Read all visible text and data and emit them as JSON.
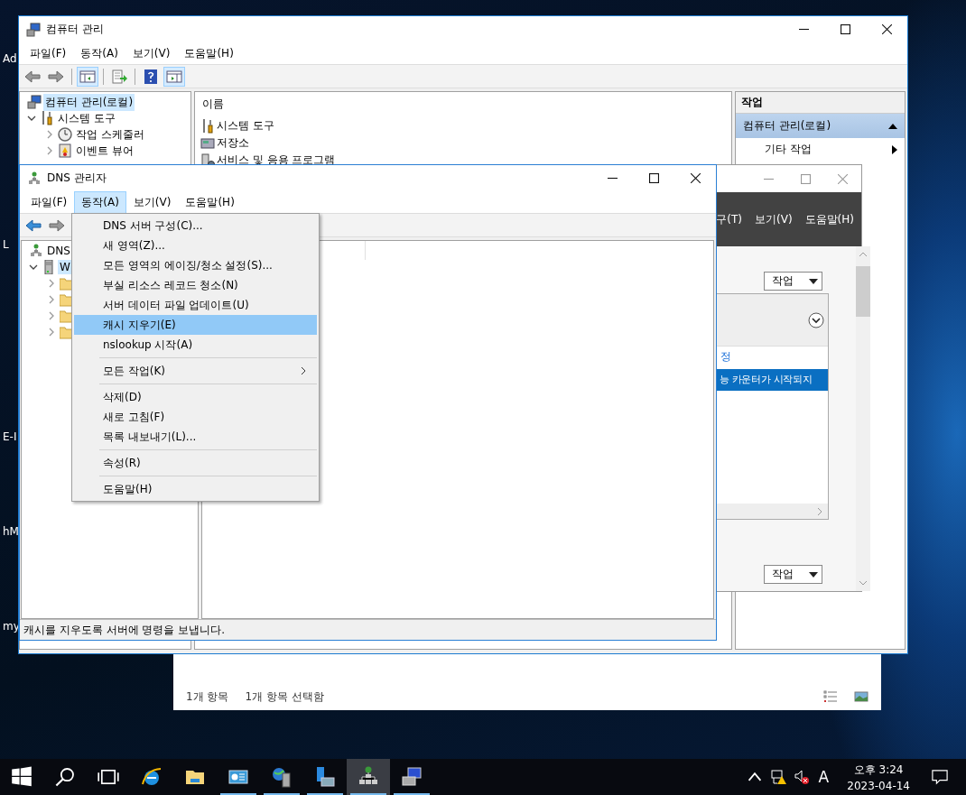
{
  "desktop_labels": [
    "Ad",
    "L",
    "E-I",
    "hM",
    "my"
  ],
  "explorer_window": {
    "status": [
      "1개 항목",
      "1개 항목 선택함"
    ]
  },
  "computer_management": {
    "title": "컴퓨터 관리",
    "menu": [
      "파일(F)",
      "동작(A)",
      "보기(V)",
      "도움말(H)"
    ],
    "tree": [
      {
        "label": "컴퓨터 관리(로컬)",
        "kind": "computer",
        "selected": true,
        "children": [
          {
            "label": "시스템 도구",
            "kind": "tools",
            "selected": false,
            "expanded": true,
            "children": [
              {
                "label": "작업 스케줄러",
                "kind": "clock",
                "selected": false,
                "expanded": false
              },
              {
                "label": "이벤트 뷰어",
                "kind": "event",
                "selected": false,
                "expanded": false
              }
            ]
          }
        ]
      }
    ],
    "list_header": "이름",
    "list": [
      {
        "label": "시스템 도구",
        "kind": "tools"
      },
      {
        "label": "저장소",
        "kind": "storage"
      },
      {
        "label": "서비스 및 응용 프로그램",
        "kind": "services"
      }
    ],
    "actions": {
      "header": "작업",
      "group": {
        "label": "컴퓨터 관리(로컬)",
        "expanded": true
      },
      "items": [
        "기타 작업"
      ]
    }
  },
  "server_manager": {
    "menu": [
      "구(T)",
      "보기(V)",
      "도움말(H)"
    ],
    "tasks_button": "작업",
    "link": "정",
    "selected_row": "능 카운터가 시작되지",
    "tasks_button_bottom": "작업"
  },
  "dns_manager": {
    "title": "DNS 관리자",
    "menu": [
      {
        "label": "파일(F)",
        "selected": false
      },
      {
        "label": "동작(A)",
        "selected": true
      },
      {
        "label": "보기(V)",
        "selected": false
      },
      {
        "label": "도움말(H)",
        "selected": false
      }
    ],
    "tree": [
      {
        "label": "DNS",
        "kind": "dns",
        "selected": false,
        "children": [
          {
            "label": "W",
            "kind": "server",
            "selected": true,
            "expanded": true,
            "children": [
              {
                "kind": "folder",
                "expanded": false
              },
              {
                "kind": "folder",
                "expanded": false
              },
              {
                "kind": "folder",
                "expanded": false
              },
              {
                "kind": "folder",
                "expanded": false
              }
            ]
          }
        ]
      }
    ],
    "status": "캐시를 지우도록 서버에 명령을 보냅니다."
  },
  "context_menu": [
    {
      "kind": "item",
      "label": "DNS 서버 구성(C)...",
      "selected": false
    },
    {
      "kind": "item",
      "label": "새 영역(Z)...",
      "selected": false
    },
    {
      "kind": "item",
      "label": "모든 영역의 에이징/청소 설정(S)...",
      "selected": false
    },
    {
      "kind": "item",
      "label": "부실 리소스 레코드 청소(N)",
      "selected": false
    },
    {
      "kind": "item",
      "label": "서버 데이터 파일 업데이트(U)",
      "selected": false
    },
    {
      "kind": "item",
      "label": "캐시 지우기(E)",
      "selected": true
    },
    {
      "kind": "item",
      "label": "nslookup 시작(A)",
      "selected": false
    },
    {
      "kind": "separator"
    },
    {
      "kind": "submenu",
      "label": "모든 작업(K)",
      "selected": false
    },
    {
      "kind": "separator"
    },
    {
      "kind": "item",
      "label": "삭제(D)",
      "selected": false
    },
    {
      "kind": "item",
      "label": "새로 고침(F)",
      "selected": false
    },
    {
      "kind": "item",
      "label": "목록 내보내기(L)...",
      "selected": false
    },
    {
      "kind": "separator"
    },
    {
      "kind": "item",
      "label": "속성(R)",
      "selected": false
    },
    {
      "kind": "separator"
    },
    {
      "kind": "item",
      "label": "도움말(H)",
      "selected": false
    }
  ],
  "taskbar": {
    "apps": [
      {
        "kind": "ie",
        "running": false,
        "selected": false
      },
      {
        "kind": "folder",
        "running": false,
        "selected": false
      },
      {
        "kind": "dashboard",
        "running": true,
        "selected": false
      },
      {
        "kind": "globe-server",
        "running": true,
        "selected": false
      },
      {
        "kind": "folder-server",
        "running": true,
        "selected": false
      },
      {
        "kind": "network",
        "running": true,
        "selected": true
      },
      {
        "kind": "computer",
        "running": true,
        "selected": false
      }
    ],
    "ime": "A",
    "time": "오후 3:24",
    "date": "2023-04-14"
  }
}
